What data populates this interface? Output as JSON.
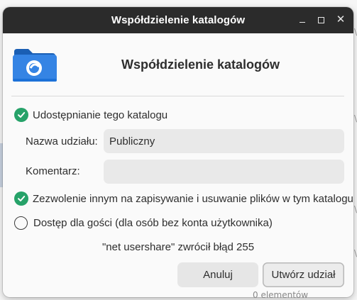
{
  "window": {
    "title": "Współdzielenie katalogów",
    "controls": {
      "minimize_icon": "minimize-icon",
      "maximize_icon": "maximize-icon",
      "close_icon": "close-icon"
    }
  },
  "header": {
    "icon": "folder-share-icon",
    "title": "Współdzielenie katalogów"
  },
  "share_checkbox": {
    "label": "Udostępnianie tego katalogu",
    "checked": true
  },
  "share_name": {
    "label": "Nazwa udziału:",
    "value": "Publiczny",
    "placeholder": ""
  },
  "comment": {
    "label": "Komentarz:",
    "value": "",
    "placeholder": ""
  },
  "write_checkbox": {
    "label": "Zezwolenie innym na zapisywanie i usuwanie plików w tym katalogu",
    "checked": true
  },
  "guest_checkbox": {
    "label": "Dostęp dla gości (dla osób bez konta użytkownika)",
    "checked": false
  },
  "status_message": "\"net usershare\" zwrócił błąd 255",
  "buttons": {
    "cancel": "Anuluj",
    "create": "Utwórz udział"
  },
  "colors": {
    "accent_check": "#26a269",
    "folder_blue": "#1c71d8",
    "titlebar": "#2b2b2b"
  }
}
